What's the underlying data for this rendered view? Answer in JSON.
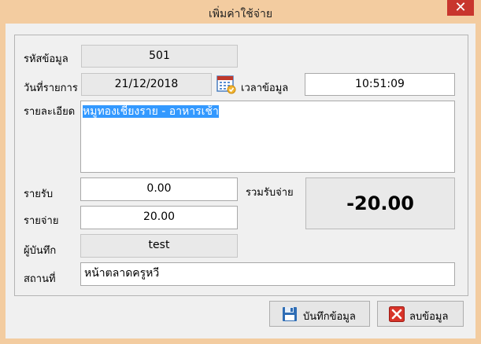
{
  "window": {
    "title": "เพิ่มค่าใช้จ่าย",
    "close_glyph": "✕"
  },
  "form": {
    "id_label": "รหัสข้อมูล",
    "id_value": "501",
    "date_label": "วันที่รายการ",
    "date_value": "21/12/2018",
    "time_label": "เวลาข้อมูล",
    "time_value": "10:51:09",
    "detail_label": "รายละเอียด",
    "detail_value": "หมูทองเชียงราย - อาหารเช้า",
    "income_label": "รายรับ",
    "income_value": "0.00",
    "expense_label": "รายจ่าย",
    "expense_value": "20.00",
    "total_label": "รวมรับจ่าย",
    "total_value": "-20.00",
    "recorder_label": "ผู้บันทึก",
    "recorder_value": "test",
    "place_label": "สถานที่",
    "place_value": "หน้าตลาดครูหวี"
  },
  "buttons": {
    "save_label": "บันทึกข้อมูล",
    "delete_label": "ลบข้อมูล"
  },
  "icons": {
    "calendar": "calendar-icon",
    "save": "floppy-disk-icon",
    "delete": "red-x-icon"
  },
  "colors": {
    "titlebar": "#f3cca0",
    "close": "#c8362d",
    "selection": "#3399ff"
  }
}
